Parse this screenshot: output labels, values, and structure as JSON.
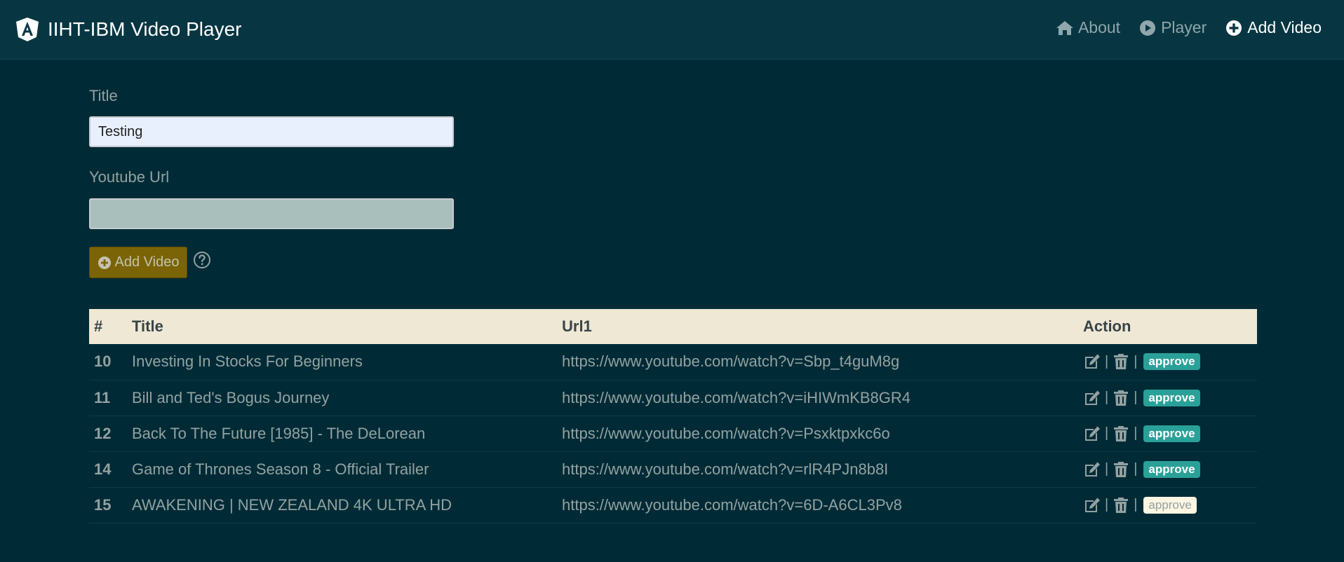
{
  "header": {
    "brand": "IIHT-IBM Video Player",
    "nav": [
      {
        "label": "About",
        "icon": "home-icon"
      },
      {
        "label": "Player",
        "icon": "play-circle-icon"
      },
      {
        "label": "Add Video",
        "icon": "plus-circle-icon"
      }
    ]
  },
  "form": {
    "title_label": "Title",
    "title_value": "Testing",
    "url_label": "Youtube Url",
    "url_value": "",
    "add_button": "Add Video"
  },
  "table": {
    "headers": [
      "#",
      "Title",
      "Url1",
      "Action"
    ],
    "rows": [
      {
        "id": "10",
        "title": "Investing In Stocks For Beginners",
        "url": "https://www.youtube.com/watch?v=Sbp_t4guM8g",
        "approve": "approve",
        "approved": true
      },
      {
        "id": "11",
        "title": "Bill and Ted's Bogus Journey",
        "url": "https://www.youtube.com/watch?v=iHIWmKB8GR4",
        "approve": "approve",
        "approved": true
      },
      {
        "id": "12",
        "title": "Back To The Future [1985] - The DeLorean",
        "url": "https://www.youtube.com/watch?v=Psxktpxkc6o",
        "approve": "approve",
        "approved": true
      },
      {
        "id": "14",
        "title": "Game of Thrones Season 8 - Official Trailer",
        "url": "https://www.youtube.com/watch?v=rlR4PJn8b8I",
        "approve": "approve",
        "approved": true
      },
      {
        "id": "15",
        "title": "AWAKENING | NEW ZEALAND 4K ULTRA HD",
        "url": "https://www.youtube.com/watch?v=6D-A6CL3Pv8",
        "approve": "approve",
        "approved": false
      }
    ]
  },
  "colors": {
    "background": "#002b36",
    "navbar": "#073642",
    "table_header": "#eee8d5",
    "approve": "#2aa198",
    "add_button": "#7a6406"
  }
}
